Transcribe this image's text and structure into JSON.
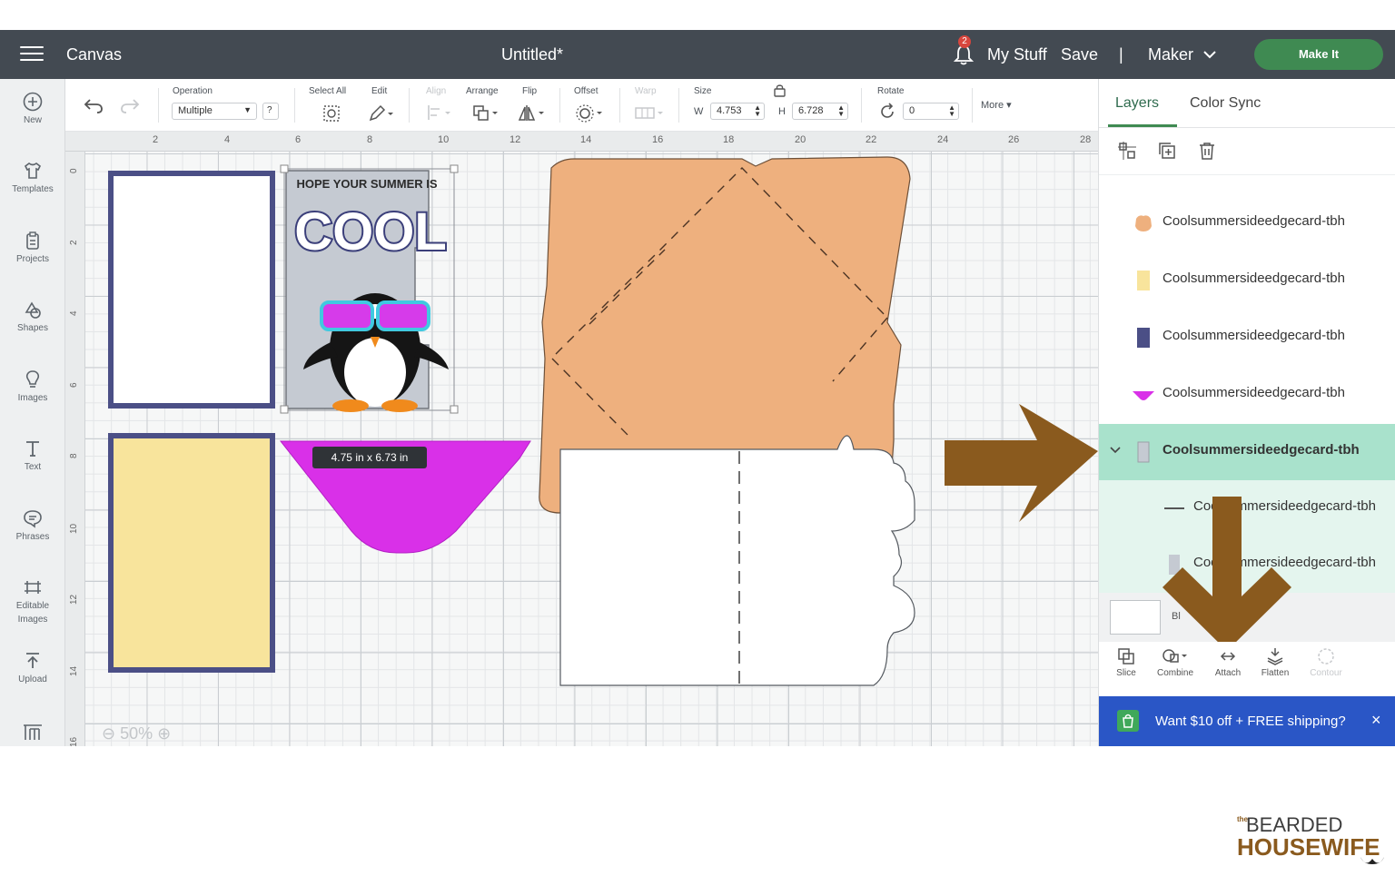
{
  "topbar": {
    "app_section": "Canvas",
    "doc_title": "Untitled*",
    "notif_count": "2",
    "my_stuff": "My Stuff",
    "save": "Save",
    "divider": "|",
    "machine": "Maker",
    "make_it": "Make It"
  },
  "sidebar": [
    {
      "label": "New",
      "icon": "plus-circle-icon"
    },
    {
      "label": "Templates",
      "icon": "shirt-icon"
    },
    {
      "label": "Projects",
      "icon": "clipboard-icon"
    },
    {
      "label": "Shapes",
      "icon": "shapes-icon"
    },
    {
      "label": "Images",
      "icon": "lightbulb-icon"
    },
    {
      "label": "Text",
      "icon": "text-icon"
    },
    {
      "label": "Phrases",
      "icon": "speech-bubble-icon"
    },
    {
      "label": "Editable",
      "label2": "Images",
      "icon": "editable-images-icon"
    },
    {
      "label": "Upload",
      "icon": "upload-icon"
    }
  ],
  "toolbar": {
    "operation_label": "Operation",
    "operation_value": "Multiple",
    "help": "?",
    "select_all": "Select All",
    "edit": "Edit",
    "align": "Align",
    "arrange": "Arrange",
    "flip": "Flip",
    "offset": "Offset",
    "warp": "Warp",
    "size": "Size",
    "w_label": "W",
    "w_value": "4.753",
    "h_label": "H",
    "h_value": "6.728",
    "rotate": "Rotate",
    "rotate_value": "0",
    "more": "More"
  },
  "canvas": {
    "ruler_x": [
      "2",
      "4",
      "6",
      "8",
      "10",
      "12",
      "14",
      "16",
      "18",
      "20",
      "22",
      "24",
      "26",
      "28"
    ],
    "ruler_y": [
      "0",
      "2",
      "4",
      "6",
      "8",
      "10",
      "12",
      "14",
      "16"
    ],
    "zoom": "50%",
    "size_tip": "4.75  in x 6.73  in",
    "card_headline": "HOPE YOUR SUMMER IS",
    "card_big_word": "COOL",
    "colors": {
      "navy": "#4b4f86",
      "yellow": "#f8e49c",
      "magenta": "#d930e8",
      "peach": "#eeb07e",
      "grey_card": "#c5cad2",
      "arrow": "#8a5a1e"
    }
  },
  "panel": {
    "tab_layers": "Layers",
    "tab_color_sync": "Color Sync",
    "layers": [
      {
        "name": "Coolsummersideedgecard-tbh",
        "swatch": "#eeb07e",
        "shape": "blob"
      },
      {
        "name": "Coolsummersideedgecard-tbh",
        "swatch": "#f8e49c",
        "shape": "rect"
      },
      {
        "name": "Coolsummersideedgecard-tbh",
        "swatch": "#4b4f86",
        "shape": "rect"
      },
      {
        "name": "Coolsummersideedgecard-tbh",
        "swatch": "#d930e8",
        "shape": "triangle"
      },
      {
        "name": "Coolsummersideedgecard-tbh",
        "swatch": "#c5cad2",
        "shape": "card",
        "selected": true
      },
      {
        "name": "Coolsummersideedgecard-tbh",
        "swatch": "#555555",
        "shape": "line"
      },
      {
        "name": "Coolsummersideedgecard-tbh",
        "swatch": "#c5cad2",
        "shape": "card"
      }
    ],
    "blank_label": "Bl",
    "tools": [
      "Slice",
      "Combine",
      "Attach",
      "Flatten",
      "Contour"
    ],
    "promo": "Want $10 off + FREE shipping?",
    "promo_close": "×"
  },
  "watermark": {
    "line1": "BEARDED",
    "line2": "HOUSEWIFE",
    "prefix": "the"
  }
}
